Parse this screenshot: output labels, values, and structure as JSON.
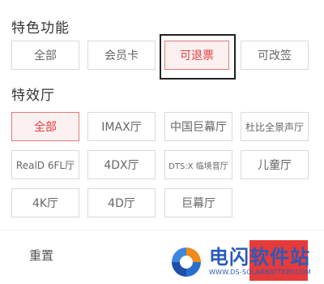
{
  "features": {
    "title": "特色功能",
    "options": [
      "全部",
      "会员卡",
      "可退票",
      "可改签"
    ]
  },
  "halls": {
    "title": "特效厅",
    "options": [
      "全部",
      "IMAX厅",
      "中国巨幕厅",
      "杜比全景声厅",
      "RealD 6FL厅",
      "4DX厅",
      "DTS:X 临境音厅",
      "儿童厅",
      "4K厅",
      "4D厅",
      "巨幕厅"
    ]
  },
  "footer": {
    "reset_label": "重置",
    "confirm_color": "#e63b3b"
  },
  "watermark": {
    "title": "电闪软件站",
    "url": "WWW.DS-SOLARBATTERY.COM"
  },
  "colors": {
    "selected_border": "#e07a7a",
    "selected_text": "#e23c3c",
    "selected_bg": "#fdf0f0"
  }
}
